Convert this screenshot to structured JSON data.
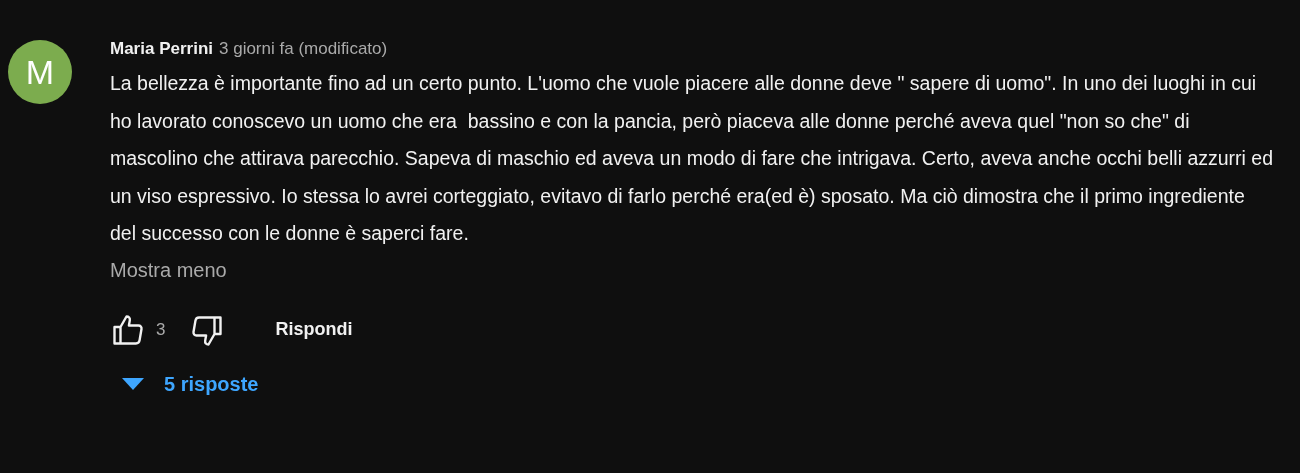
{
  "comment": {
    "avatar_letter": "M",
    "author": "Maria Perrini",
    "time": "3 giorni fa (modificato)",
    "text": "La bellezza è importante fino ad un certo punto. L'uomo che vuole piacere alle donne deve \" sapere di uomo\". In uno dei luoghi in cui ho lavorato conoscevo un uomo che era  bassino e con la pancia, però piaceva alle donne perché aveva quel \"non so che\" di mascolino che attirava parecchio. Sapeva di maschio ed aveva un modo di fare che intrigava. Certo, aveva anche occhi belli azzurri ed un viso espressivo. Io stessa lo avrei corteggiato, evitavo di farlo perché era(ed è) sposato. Ma ciò dimostra che il primo ingrediente del successo con le donne è saperci fare.",
    "show_less": "Mostra meno",
    "likes": "3",
    "reply": "Rispondi",
    "replies": "5 risposte"
  }
}
